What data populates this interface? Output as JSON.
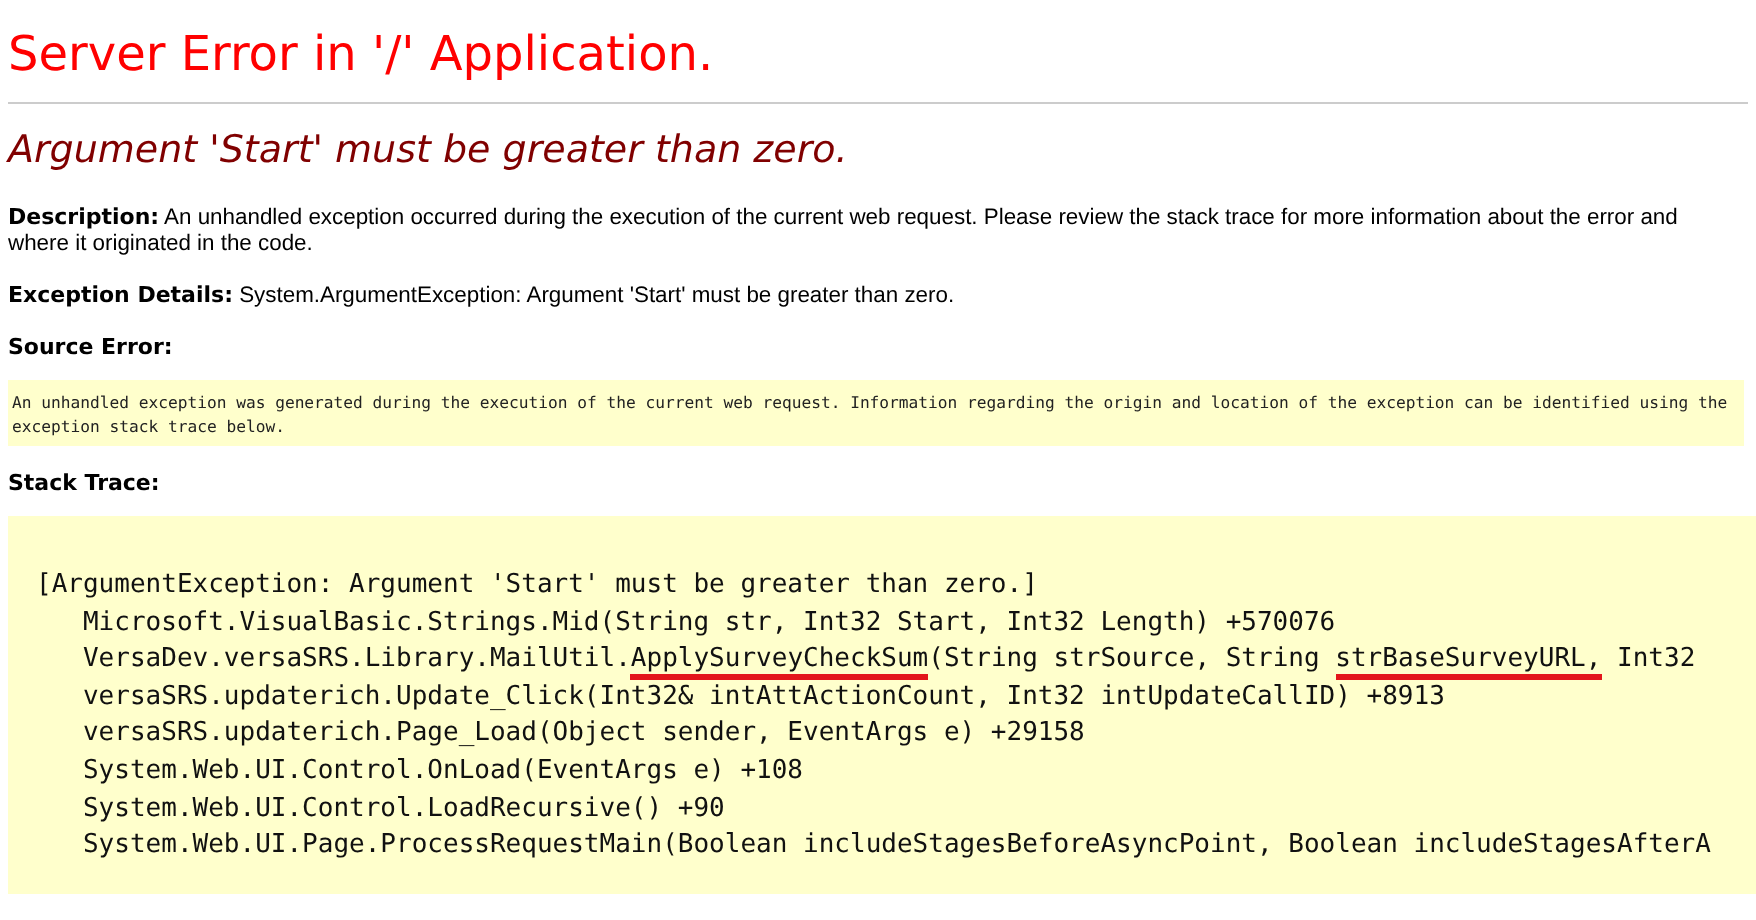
{
  "title": "Server Error in '/' Application.",
  "error_message": "Argument 'Start' must be greater than zero.",
  "details": [
    {
      "text": "**Description:** An unhandled exception occurred during the execution of the current web request. Please review the stack trace for more information about the error and where it originated in the code."
    },
    {
      "text": "**Exception Details:** System.ArgumentException: Argument 'Start' must be greater than zero."
    }
  ],
  "source_error": {
    "heading": "Source Error:",
    "text": "An unhandled exception was generated during the execution of the current web request. Information regarding the origin and location of the exception can be identified using the exception stack trace below."
  },
  "stack_trace": {
    "heading": "Stack Trace:",
    "lines": [
      {
        "segments": [
          {
            "text": "[ArgumentException: Argument 'Start' must be greater than zero.]",
            "marked": false
          }
        ]
      },
      {
        "segments": [
          {
            "text": "   Microsoft.VisualBasic.Strings.Mid(String str, Int32 Start, Int32 Length) +570076",
            "marked": false
          }
        ]
      },
      {
        "segments": [
          {
            "text": "   VersaDev.versaSRS.Library.MailUtil.",
            "marked": false
          },
          {
            "text": "ApplySurveyCheckSum",
            "marked": true
          },
          {
            "text": "(String strSource, String ",
            "marked": false
          },
          {
            "text": "strBaseSurveyURL,",
            "marked": true
          },
          {
            "text": " Int32",
            "marked": false
          }
        ]
      },
      {
        "segments": [
          {
            "text": "   versaSRS.updaterich.Update_Click(Int32& intAttActionCount, Int32 intUpdateCallID) +8913",
            "marked": false
          }
        ]
      },
      {
        "segments": [
          {
            "text": "   versaSRS.updaterich.Page_Load(Object sender, EventArgs e) +29158",
            "marked": false
          }
        ]
      },
      {
        "segments": [
          {
            "text": "   System.Web.UI.Control.OnLoad(EventArgs e) +108",
            "marked": false
          }
        ]
      },
      {
        "segments": [
          {
            "text": "   System.Web.UI.Control.LoadRecursive() +90",
            "marked": false
          }
        ]
      },
      {
        "segments": [
          {
            "text": "   System.Web.UI.Page.ProcessRequestMain(Boolean includeStagesBeforeAsyncPoint, Boolean includeStagesAfterA",
            "marked": false
          }
        ]
      }
    ]
  }
}
